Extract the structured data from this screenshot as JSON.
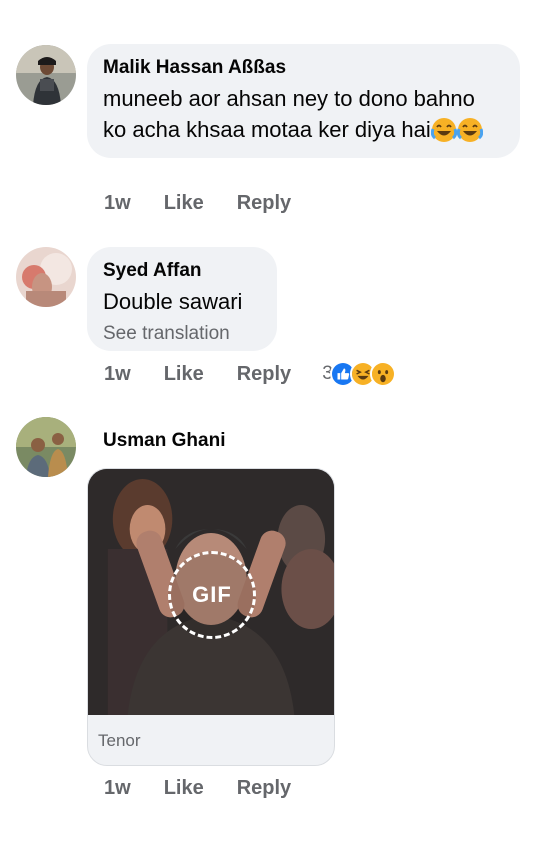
{
  "comments": [
    {
      "author": "Malik Hassan Aßßas",
      "text": "muneeb aor ahsan ney to dono bahno ko acha khsaa motaa ker diya hai",
      "emoji": [
        "face-with-tears-of-joy",
        "face-with-tears-of-joy"
      ],
      "time": "1w",
      "like": "Like",
      "reply": "Reply"
    },
    {
      "author": "Syed Affan",
      "text": "Double sawari",
      "see_translation": "See translation",
      "time": "1w",
      "like": "Like",
      "reply": "Reply",
      "reactions": {
        "count": "3",
        "types": [
          "like",
          "haha",
          "wow"
        ]
      }
    },
    {
      "author": "Usman Ghani",
      "gif": {
        "badge": "GIF",
        "source": "Tenor"
      },
      "time": "1w",
      "like": "Like",
      "reply": "Reply"
    }
  ],
  "colors": {
    "bubble": "#f0f2f5",
    "secondary_text": "#65676b",
    "like_blue": "#1877f2",
    "reaction_yellow": "#f7b125"
  }
}
